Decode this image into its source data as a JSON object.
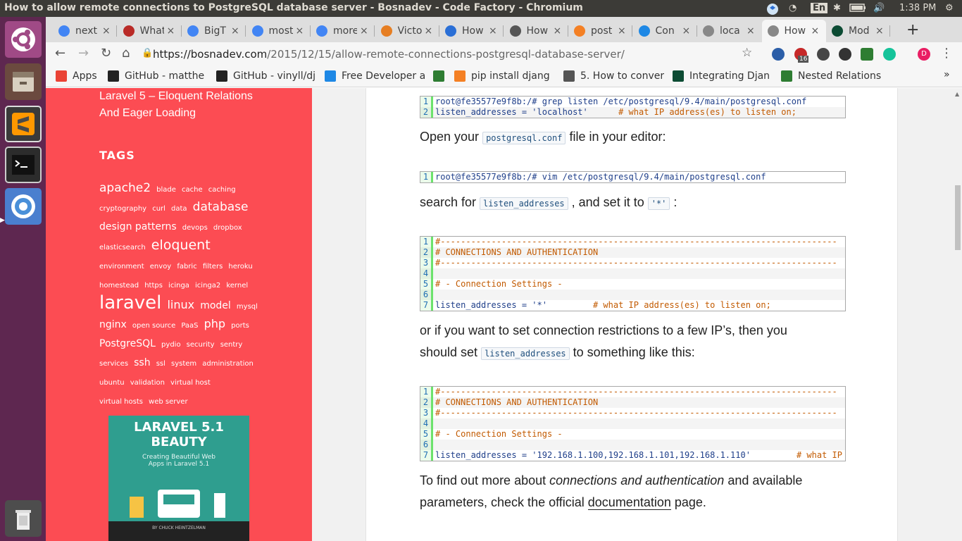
{
  "window": {
    "title": "How to allow remote connections to PostgreSQL database server - Bosnadev - Code Factory - Chromium",
    "keyboard": "En",
    "time": "1:38 PM"
  },
  "tabs": [
    {
      "label": "next",
      "favicon": "google-icon",
      "color": "#4285f4"
    },
    {
      "label": "What",
      "favicon": "quora-icon",
      "color": "#b92b27"
    },
    {
      "label": "BigT",
      "favicon": "google-icon",
      "color": "#4285f4"
    },
    {
      "label": "most",
      "favicon": "google-icon",
      "color": "#4285f4"
    },
    {
      "label": "more",
      "favicon": "google-icon",
      "color": "#4285f4"
    },
    {
      "label": "Victo",
      "favicon": "vc-icon",
      "color": "#e67e22"
    },
    {
      "label": "How",
      "favicon": "spinner-icon",
      "color": "#2a6fd6"
    },
    {
      "label": "How",
      "favicon": "plesk-icon",
      "color": "#555555"
    },
    {
      "label": "post",
      "favicon": "stackoverflow-icon",
      "color": "#f48024"
    },
    {
      "label": "Con",
      "favicon": "b-icon",
      "color": "#1e88e5"
    },
    {
      "label": "loca",
      "favicon": "page-icon",
      "color": "#888888"
    },
    {
      "label": "How",
      "favicon": "page-icon",
      "color": "#888888"
    },
    {
      "label": "Mod",
      "favicon": "django-icon",
      "color": "#0c4b33"
    }
  ],
  "toolbar": {
    "url_host": "https://bosnadev.com",
    "url_path": "/2015/12/15/allow-remote-connections-postgresql-database-server/",
    "badge_count": "16",
    "profile_letter": "D"
  },
  "bookmarks": [
    {
      "label": "Apps"
    },
    {
      "label": "GitHub - matthe"
    },
    {
      "label": "GitHub - vinyll/dj"
    },
    {
      "label": "Free Developer a"
    },
    {
      "label": ""
    },
    {
      "label": "pip install djang"
    },
    {
      "label": "5. How to conver"
    },
    {
      "label": "Integrating Djan"
    },
    {
      "label": "Nested Relations"
    }
  ],
  "sidebar": {
    "recent_post_line1": "Laravel 5 – Eloquent Relations",
    "recent_post_line2": "And Eager Loading",
    "tags_heading": "TAGS",
    "tags": [
      [
        "apache2",
        17
      ],
      [
        "blade",
        10
      ],
      [
        "cache",
        10
      ],
      [
        "caching",
        10
      ],
      [
        "cryptography",
        10
      ],
      [
        "curl",
        10
      ],
      [
        "data",
        10
      ],
      [
        "database",
        17
      ],
      [
        "design patterns",
        14
      ],
      [
        "devops",
        10
      ],
      [
        "dropbox",
        10
      ],
      [
        "elasticsearch",
        10
      ],
      [
        "eloquent",
        19
      ],
      [
        "environment",
        10
      ],
      [
        "envoy",
        10
      ],
      [
        "fabric",
        10
      ],
      [
        "filters",
        10
      ],
      [
        "heroku",
        10
      ],
      [
        "homestead",
        10
      ],
      [
        "https",
        10
      ],
      [
        "icinga",
        10
      ],
      [
        "icinga2",
        10
      ],
      [
        "kernel",
        10
      ],
      [
        "laravel",
        26
      ],
      [
        "linux",
        16
      ],
      [
        "model",
        14
      ],
      [
        "mysql",
        10
      ],
      [
        "nginx",
        14
      ],
      [
        "open source",
        10
      ],
      [
        "PaaS",
        10
      ],
      [
        "php",
        16
      ],
      [
        "ports",
        10
      ],
      [
        "PostgreSQL",
        14
      ],
      [
        "pydio",
        10
      ],
      [
        "security",
        10
      ],
      [
        "sentry",
        10
      ],
      [
        "services",
        10
      ],
      [
        "ssh",
        14
      ],
      [
        "ssl",
        10
      ],
      [
        "system",
        10
      ],
      [
        "administration",
        10
      ],
      [
        "ubuntu",
        10
      ],
      [
        "validation",
        10
      ],
      [
        "virtual host",
        10
      ],
      [
        "virtual hosts",
        10
      ],
      [
        "web server",
        10
      ]
    ],
    "book_title": "LARAVEL 5.1",
    "book_title2": "BEAUTY",
    "book_subtitle": "Creating Beautiful Web Apps in Laravel 5.1",
    "book_author": "BY CHUCK HEINTZELMAN"
  },
  "article": {
    "code1": [
      "root@fe35577e9f8b:/# grep listen /etc/postgresql/9.4/main/postgresql.conf",
      "listen_addresses = 'localhost'      # what IP address(es) to listen on;"
    ],
    "p1_before": "Open your ",
    "p1_code": "postgresql.conf",
    "p1_after": " file in your editor:",
    "code2": [
      "root@fe35577e9f8b:/# vim /etc/postgresql/9.4/main/postgresql.conf"
    ],
    "p2_before": "search for ",
    "p2_code": "listen_addresses",
    "p2_mid": " , and set it to ",
    "p2_code2": "'*'",
    "p2_after": " :",
    "code3": [
      "#------------------------------------------------------------------------------",
      "# CONNECTIONS AND AUTHENTICATION",
      "#------------------------------------------------------------------------------",
      "",
      "# - Connection Settings -",
      "",
      "listen_addresses = '*'         # what IP address(es) to listen on;"
    ],
    "p3_line1": "or if you want to set connection restrictions to a few IP’s, then you",
    "p3_before": "should set ",
    "p3_code": "listen_addresses",
    "p3_after": " to something like this:",
    "code4": [
      "#------------------------------------------------------------------------------",
      "# CONNECTIONS AND AUTHENTICATION",
      "#------------------------------------------------------------------------------",
      "",
      "# - Connection Settings -",
      "",
      "listen_addresses = '192.168.1.100,192.168.1.101,192.168.1.110'         # what IP"
    ],
    "p4_before": "To find out more about ",
    "p4_em": "connections and authentication",
    "p4_mid": " and available",
    "p4_line2_before": "parameters, check the official ",
    "p4_link": "documentation",
    "p4_after": " page."
  }
}
